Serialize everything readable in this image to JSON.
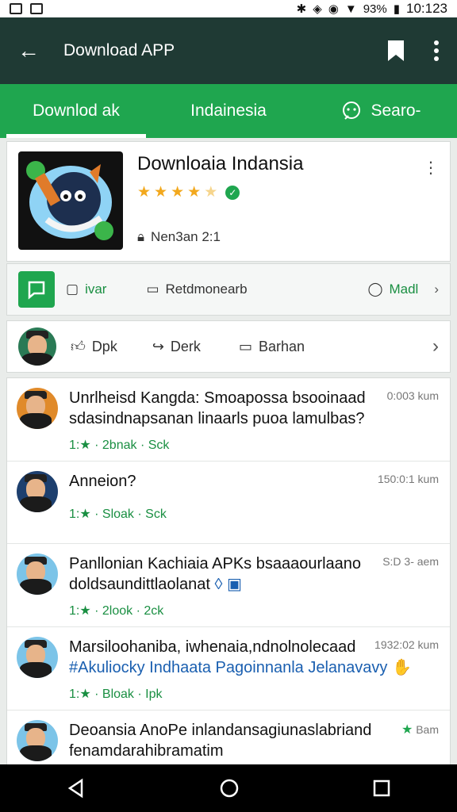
{
  "statusbar": {
    "battery": "93%",
    "time": "10:123"
  },
  "appbar": {
    "title": "Download APP"
  },
  "tabs": [
    {
      "label": "Downlod ak"
    },
    {
      "label": "Indainesia"
    },
    {
      "label": "Searo-"
    }
  ],
  "app": {
    "name": "Downloaia Indansia",
    "rating": 4.5,
    "version": "Nen3an 2:1"
  },
  "actions": {
    "review": "ivar",
    "recommend": "Retdmonearb",
    "madl": "Madl"
  },
  "social": {
    "like": "Dpk",
    "share": "Derk",
    "comment": "Barhan"
  },
  "feed": [
    {
      "text": "Unrlheisd Kangda: Smoapossa bsooinaad sdasindnapsanan linaarls puoa lamulbas?",
      "blue": "",
      "meta": "1:★ · 2bnak · Sck",
      "time": "0:003 kum"
    },
    {
      "text": "Anneion?",
      "blue": "",
      "meta": "1:★ · Sloak · Sck",
      "time": "150:0:1 kum"
    },
    {
      "text": "Panllonian Kachiaia APKs bsaaaourlaano doldsaundittlaolanat",
      "blue": "",
      "meta": "1:★ · 2look · 2ck",
      "time": "S:D 3- aem"
    },
    {
      "text": "Marsiloohaniba, iwhenaia,ndnolnolecaad",
      "blue": "#Akuliocky Indhaata Pagoinnanla Jelanavavy",
      "meta": "1:★ · Bloak · Ipk",
      "time": "1932:02 kum"
    },
    {
      "text": "Deoansia AnoPe inlandansagiunaslabriand fenamdarahibramatim",
      "blue": "",
      "meta": "",
      "time": "Bam"
    }
  ],
  "colors": {
    "appbar": "#1f3a34",
    "accent": "#1fa64f",
    "navbar": "#000000"
  }
}
